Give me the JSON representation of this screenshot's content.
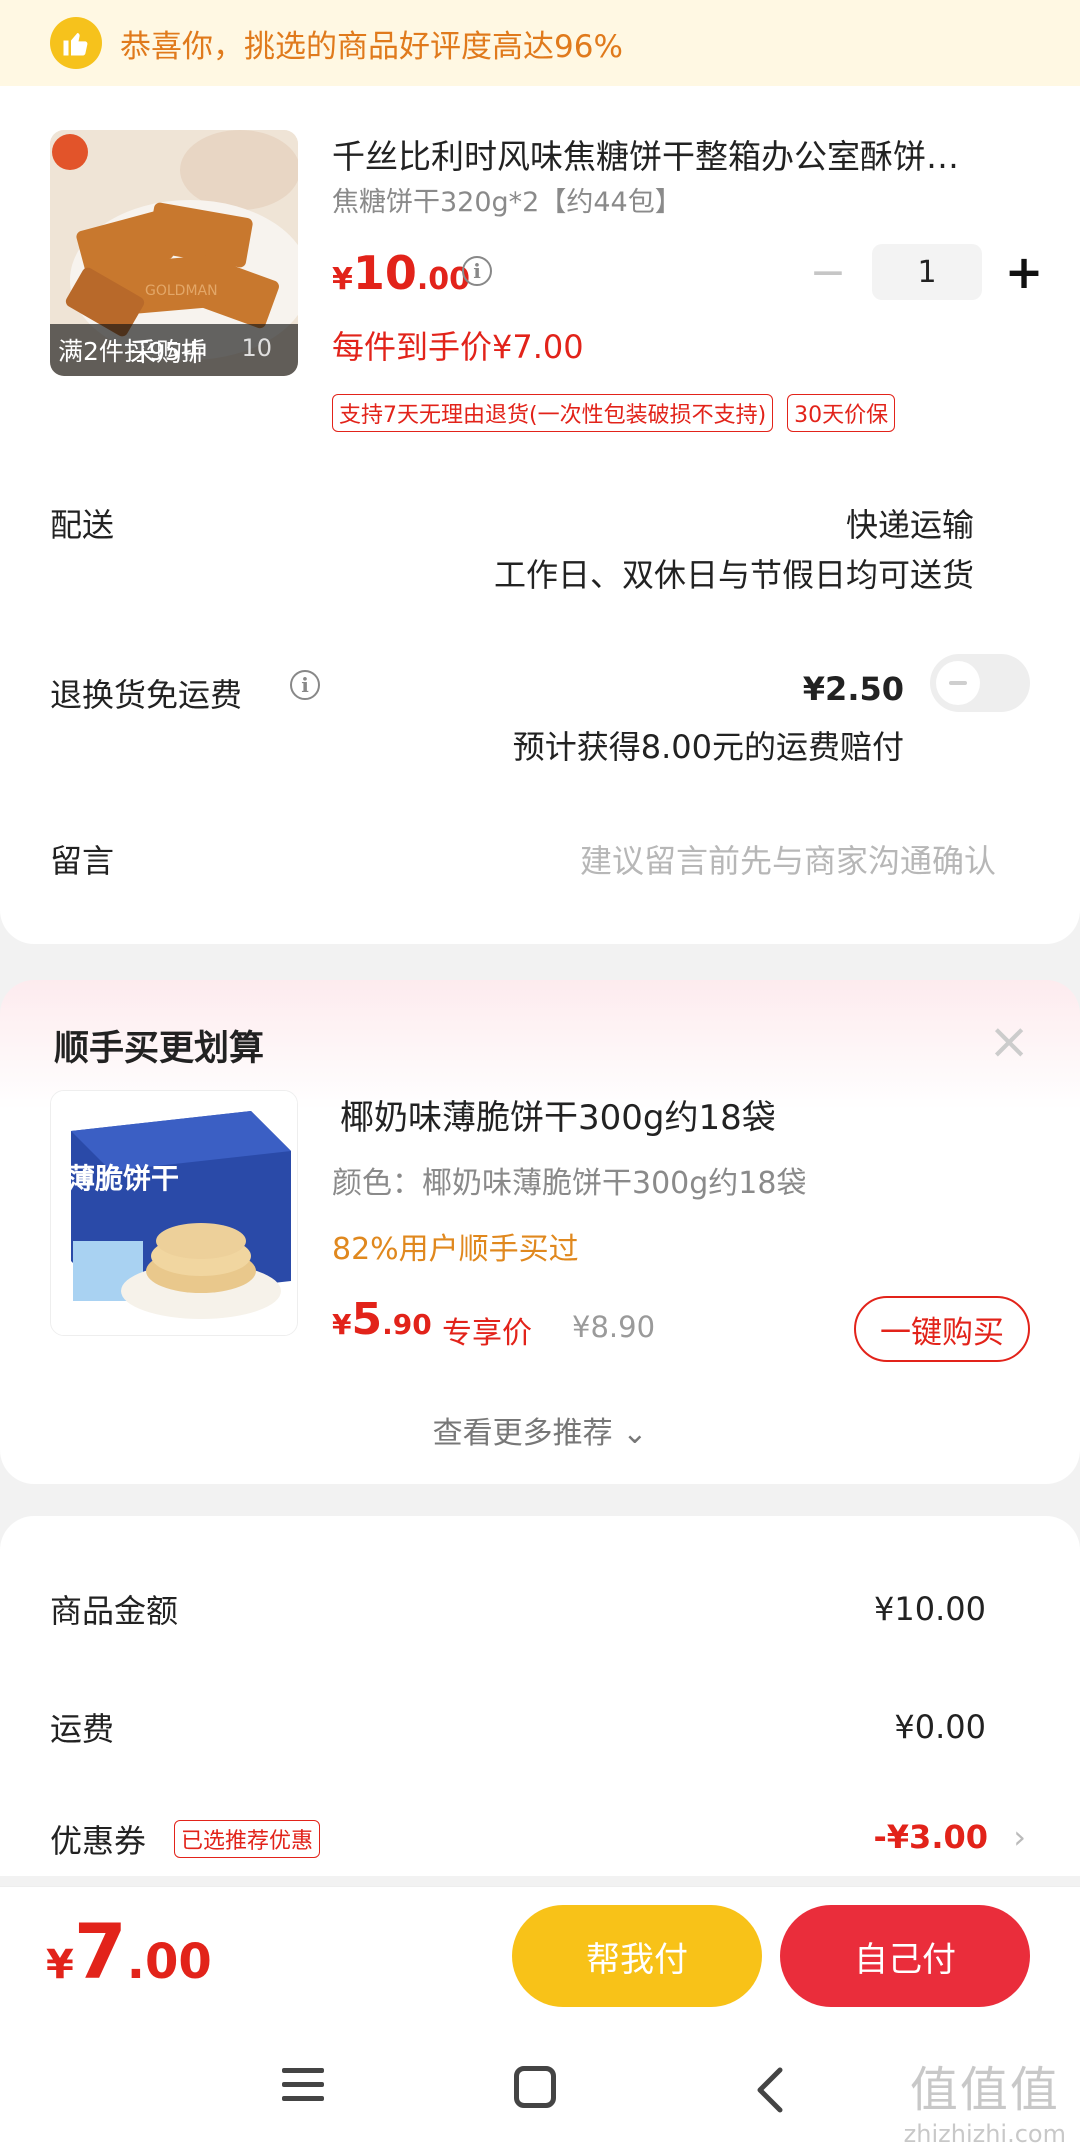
{
  "banner": {
    "text": "恭喜你，挑选的商品好评度高达96%",
    "icon": "thumbs-up-icon"
  },
  "product": {
    "title": "千丝比利时风味焦糖饼干整箱办公室酥饼…",
    "spec": "焦糖饼干320g*2【约44包】",
    "price_yen": "¥",
    "price_int": "10",
    "price_dec": ".00",
    "image_caption_left": "满2件打95折",
    "image_caption_mid": "采购中",
    "image_caption_num": "10",
    "quantity": "1",
    "minus": "−",
    "plus": "+",
    "hand_price": "每件到手价¥7.00",
    "tags": [
      "支持7天无理由退货(一次性包装破损不支持)",
      "30天价保"
    ]
  },
  "shipping": {
    "label": "配送",
    "method": "快递运输",
    "note": "工作日、双休日与节假日均可送货"
  },
  "return_free": {
    "label": "退换货免运费",
    "price": "¥2.50",
    "compensation": "预计获得8.00元的运费赔付",
    "enabled": false
  },
  "message": {
    "label": "留言",
    "placeholder": "建议留言前先与商家沟通确认"
  },
  "recommend": {
    "title": "顺手买更划算",
    "close": "×",
    "item": {
      "name": "椰奶味薄脆饼干300g约18袋",
      "color": "颜色：椰奶味薄脆饼干300g约18袋",
      "bought": "82%用户顺手买过",
      "price_yen": "¥",
      "price_int": "5",
      "price_dec": ".90",
      "exclusive": "专享价",
      "original": "¥8.90",
      "buy_label": "一键购买",
      "image_text": "薄脆饼干"
    },
    "more": "查看更多推荐 ⌄"
  },
  "summary": {
    "goods_label": "商品金额",
    "goods_value": "¥10.00",
    "freight_label": "运费",
    "freight_value": "¥0.00",
    "coupon_label": "优惠券",
    "coupon_tag": "已选推荐优惠",
    "coupon_value": "-¥3.00",
    "chevron": "›"
  },
  "paybar": {
    "total_yen": "¥",
    "total_int": "7",
    "total_dec": ".00",
    "help_pay": "帮我付",
    "self_pay": "自己付"
  },
  "watermark": {
    "big": "值值值",
    "small": "zhizhizhi.com"
  },
  "colors": {
    "accent_red": "#e2231a",
    "accent_yellow": "#f8c218",
    "pay_red": "#ea2d3b",
    "orange_text": "#e07a1c"
  }
}
